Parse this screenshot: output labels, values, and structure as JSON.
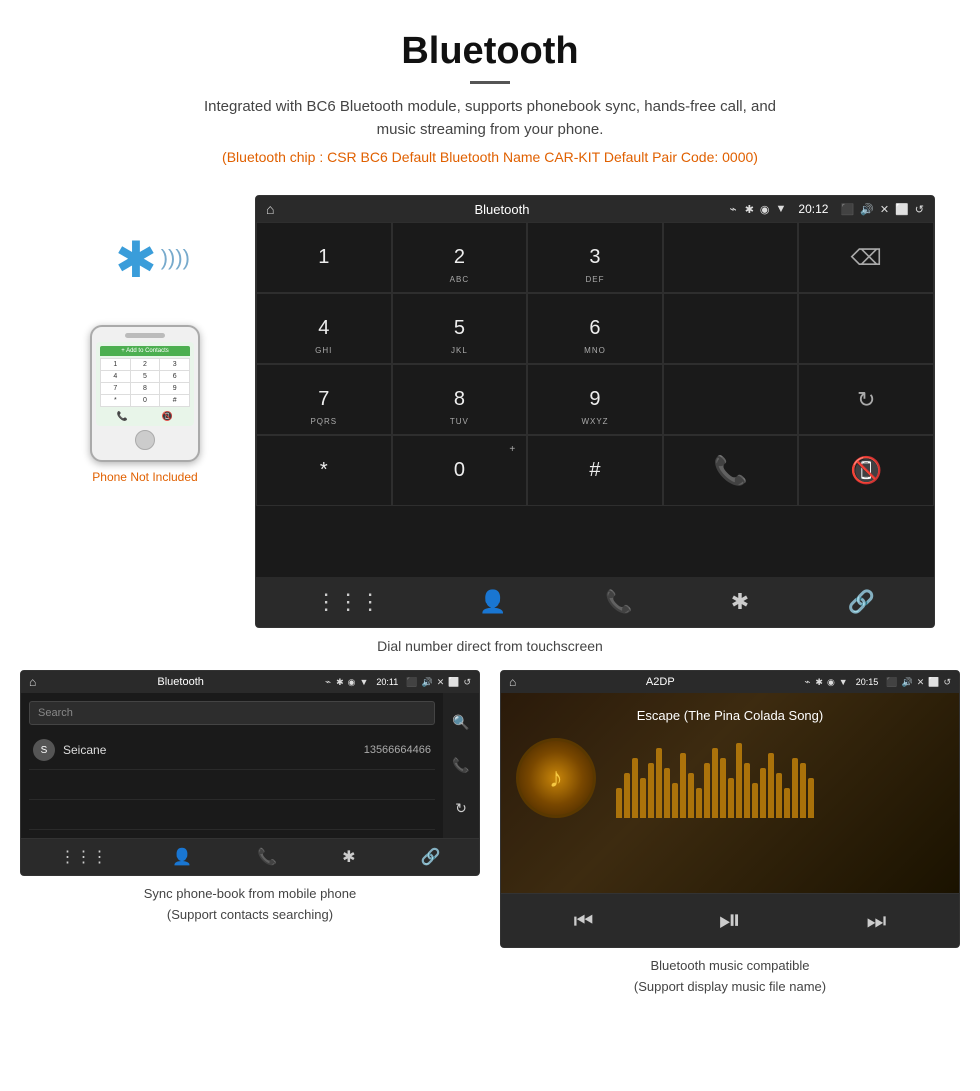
{
  "header": {
    "title": "Bluetooth",
    "description": "Integrated with BC6 Bluetooth module, supports phonebook sync, hands-free call, and music streaming from your phone.",
    "spec_line": "(Bluetooth chip : CSR BC6    Default Bluetooth Name CAR-KIT    Default Pair Code: 0000)"
  },
  "car_screen": {
    "status_bar": {
      "title": "Bluetooth",
      "usb_char": "⌁",
      "time": "20:12",
      "home_icon": "⌂"
    },
    "dialpad": {
      "keys": [
        {
          "label": "1",
          "sub": ""
        },
        {
          "label": "2",
          "sub": "ABC"
        },
        {
          "label": "3",
          "sub": "DEF"
        },
        {
          "label": "",
          "sub": ""
        },
        {
          "label": "⌫",
          "sub": ""
        },
        {
          "label": "4",
          "sub": "GHI"
        },
        {
          "label": "5",
          "sub": "JKL"
        },
        {
          "label": "6",
          "sub": "MNO"
        },
        {
          "label": "",
          "sub": ""
        },
        {
          "label": "",
          "sub": ""
        },
        {
          "label": "7",
          "sub": "PQRS"
        },
        {
          "label": "8",
          "sub": "TUV"
        },
        {
          "label": "9",
          "sub": "WXYZ"
        },
        {
          "label": "",
          "sub": ""
        },
        {
          "label": "↺",
          "sub": ""
        },
        {
          "label": "*",
          "sub": ""
        },
        {
          "label": "0",
          "sub": "+"
        },
        {
          "label": "#",
          "sub": ""
        },
        {
          "label": "📞",
          "sub": ""
        },
        {
          "label": "📵",
          "sub": ""
        }
      ]
    },
    "bottom_nav": {
      "icons": [
        "⋮⋮⋮",
        "👤",
        "📞",
        "✱",
        "🔗"
      ]
    }
  },
  "caption_main": "Dial number direct from touchscreen",
  "phone_label": "Phone Not Included",
  "phonebook_screen": {
    "status_bar_title": "Bluetooth",
    "time": "20:11",
    "search_placeholder": "Search",
    "contact": {
      "initial": "S",
      "name": "Seicane",
      "phone": "13566664466"
    },
    "bottom_icons": [
      "⋮⋮⋮",
      "👤",
      "📞",
      "✱",
      "🔗"
    ],
    "right_icons": [
      "🔍",
      "📞",
      "↺"
    ]
  },
  "music_screen": {
    "status_bar_title": "A2DP",
    "time": "20:15",
    "song_title": "Escape (The Pina Colada Song)",
    "eq_heights": [
      30,
      45,
      60,
      40,
      55,
      70,
      50,
      35,
      65,
      45,
      30,
      55,
      70,
      60,
      40,
      75,
      55,
      35,
      50,
      65,
      45,
      30,
      60,
      55,
      40
    ],
    "controls": [
      "⏮",
      "⏯",
      "⏭"
    ]
  },
  "caption_phonebook": "Sync phone-book from mobile phone\n(Support contacts searching)",
  "caption_music": "Bluetooth music compatible\n(Support display music file name)"
}
